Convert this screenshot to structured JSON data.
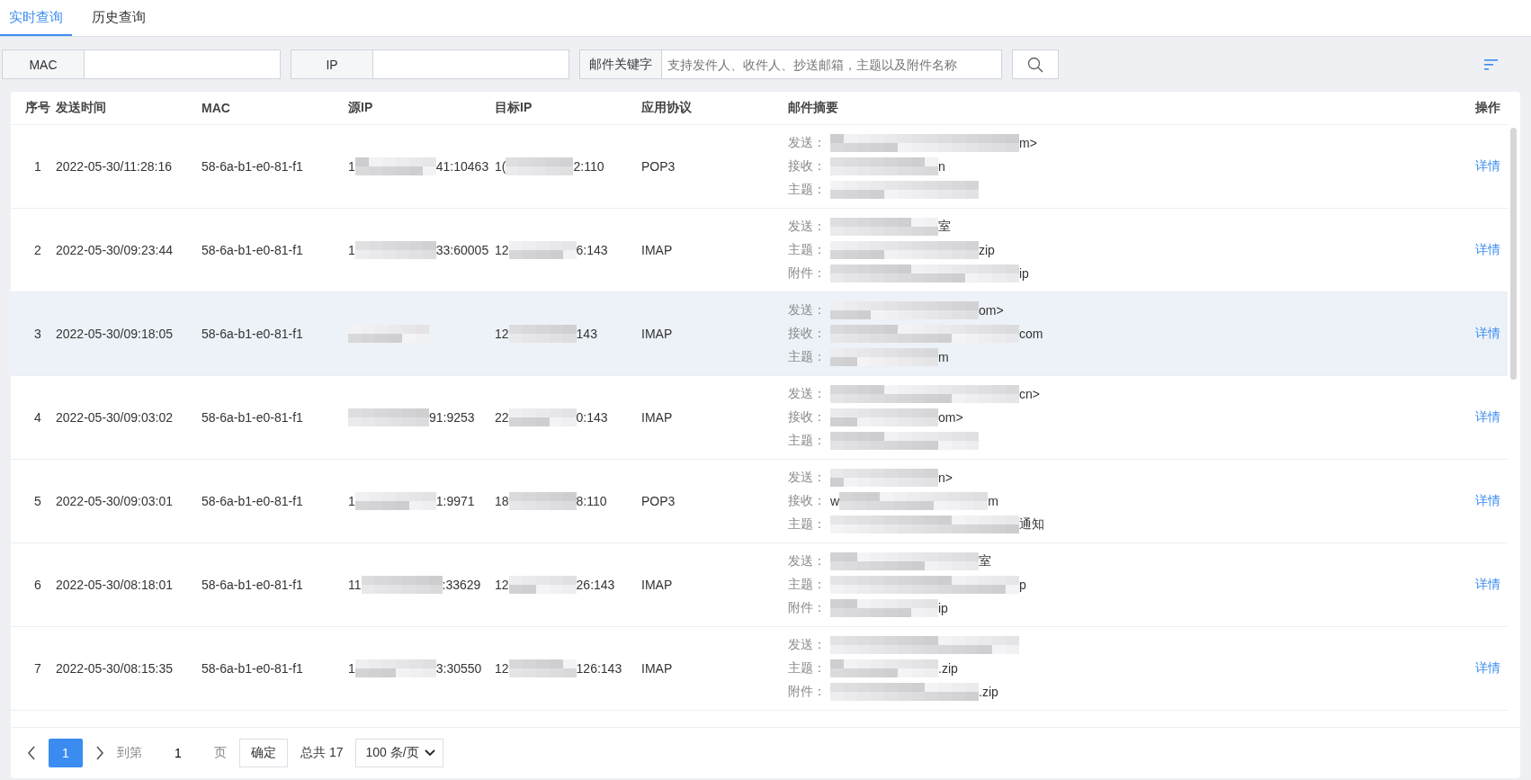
{
  "tabs": [
    {
      "label": "实时查询",
      "selected": true
    },
    {
      "label": "历史查询",
      "selected": false
    }
  ],
  "filters": [
    {
      "label": "MAC",
      "kind": "field"
    },
    {
      "label": "IP",
      "kind": "field"
    },
    {
      "label": "邮件关键字",
      "kind": "field",
      "placeholder": "支持发件人、收件人、抄送邮箱，主题以及附件名称"
    }
  ],
  "table": {
    "columns": [
      "序号",
      "发送时间",
      "MAC",
      "源IP",
      "目标IP",
      "应用协议",
      "邮件摘要",
      "操作"
    ],
    "rows": [
      {
        "index": "1",
        "time": "2022-05-30/11:28:16",
        "mac": "58-6a-b1-e0-81-f1",
        "src_ip": {
          "head": "1",
          "tail": "41:10463"
        },
        "dst_ip": {
          "head": "1(",
          "tail": "2:110"
        },
        "protocol": "POP3",
        "highlighted": false,
        "summary": [
          {
            "label": "发送：",
            "tail": "m>"
          },
          {
            "label": "接收：",
            "tail": "n"
          },
          {
            "label": "主题："
          }
        ],
        "action": "详情"
      },
      {
        "index": "2",
        "time": "2022-05-30/09:23:44",
        "mac": "58-6a-b1-e0-81-f1",
        "src_ip": {
          "head": "1",
          "tail": "33:60005"
        },
        "dst_ip": {
          "head": "12",
          "tail": "6:143"
        },
        "protocol": "IMAP",
        "highlighted": false,
        "summary": [
          {
            "label": "发送：",
            "tail": "室"
          },
          {
            "label": "主题：",
            "tail": "zip"
          },
          {
            "label": "附件：",
            "tail": "ip"
          }
        ],
        "action": "详情"
      },
      {
        "index": "3",
        "time": "2022-05-30/09:18:05",
        "mac": "58-6a-b1-e0-81-f1",
        "src_ip": {},
        "dst_ip": {
          "head": "12",
          "tail": "143"
        },
        "protocol": "IMAP",
        "highlighted": true,
        "summary": [
          {
            "label": "发送：",
            "tail": "om>"
          },
          {
            "label": "接收：",
            "tail": "com"
          },
          {
            "label": "主题：",
            "tail": "m"
          }
        ],
        "action": "详情"
      },
      {
        "index": "4",
        "time": "2022-05-30/09:03:02",
        "mac": "58-6a-b1-e0-81-f1",
        "src_ip": {
          "tail": "91:9253"
        },
        "dst_ip": {
          "head": "22",
          "tail": "0:143"
        },
        "protocol": "IMAP",
        "highlighted": false,
        "summary": [
          {
            "label": "发送：",
            "tail": "cn>"
          },
          {
            "label": "接收：",
            "tail": "om>"
          },
          {
            "label": "主题："
          }
        ],
        "action": "详情"
      },
      {
        "index": "5",
        "time": "2022-05-30/09:03:01",
        "mac": "58-6a-b1-e0-81-f1",
        "src_ip": {
          "head": "1",
          "tail": "1:9971"
        },
        "dst_ip": {
          "head": "18",
          "tail": "8:110"
        },
        "protocol": "POP3",
        "highlighted": false,
        "summary": [
          {
            "label": "发送：",
            "tail": "n>"
          },
          {
            "label": "接收：",
            "head": "w",
            "tail": "m"
          },
          {
            "label": "主题：",
            "tail": "通知"
          }
        ],
        "action": "详情"
      },
      {
        "index": "6",
        "time": "2022-05-30/08:18:01",
        "mac": "58-6a-b1-e0-81-f1",
        "src_ip": {
          "head": "11",
          "tail": ":33629"
        },
        "dst_ip": {
          "head": "12",
          "tail": "26:143"
        },
        "protocol": "IMAP",
        "highlighted": false,
        "summary": [
          {
            "label": "发送：",
            "tail": "室"
          },
          {
            "label": "主题：",
            "tail": "p"
          },
          {
            "label": "附件：",
            "tail": "ip"
          }
        ],
        "action": "详情"
      },
      {
        "index": "7",
        "time": "2022-05-30/08:15:35",
        "mac": "58-6a-b1-e0-81-f1",
        "src_ip": {
          "head": "1",
          "tail": "3:30550"
        },
        "dst_ip": {
          "head": "12",
          "tail": "126:143"
        },
        "protocol": "IMAP",
        "highlighted": false,
        "summary": [
          {
            "label": "发送："
          },
          {
            "label": "主题：",
            "tail": ".zip"
          },
          {
            "label": "附件：",
            "tail": ".zip"
          }
        ],
        "action": "详情"
      }
    ]
  },
  "pagination": {
    "pages": [
      {
        "label": "1",
        "selected": true
      }
    ],
    "goto_label": "到第",
    "goto_value": "1",
    "page_unit": "页",
    "confirm": "确定",
    "total": "总共 17",
    "page_size": "100 条/页"
  }
}
